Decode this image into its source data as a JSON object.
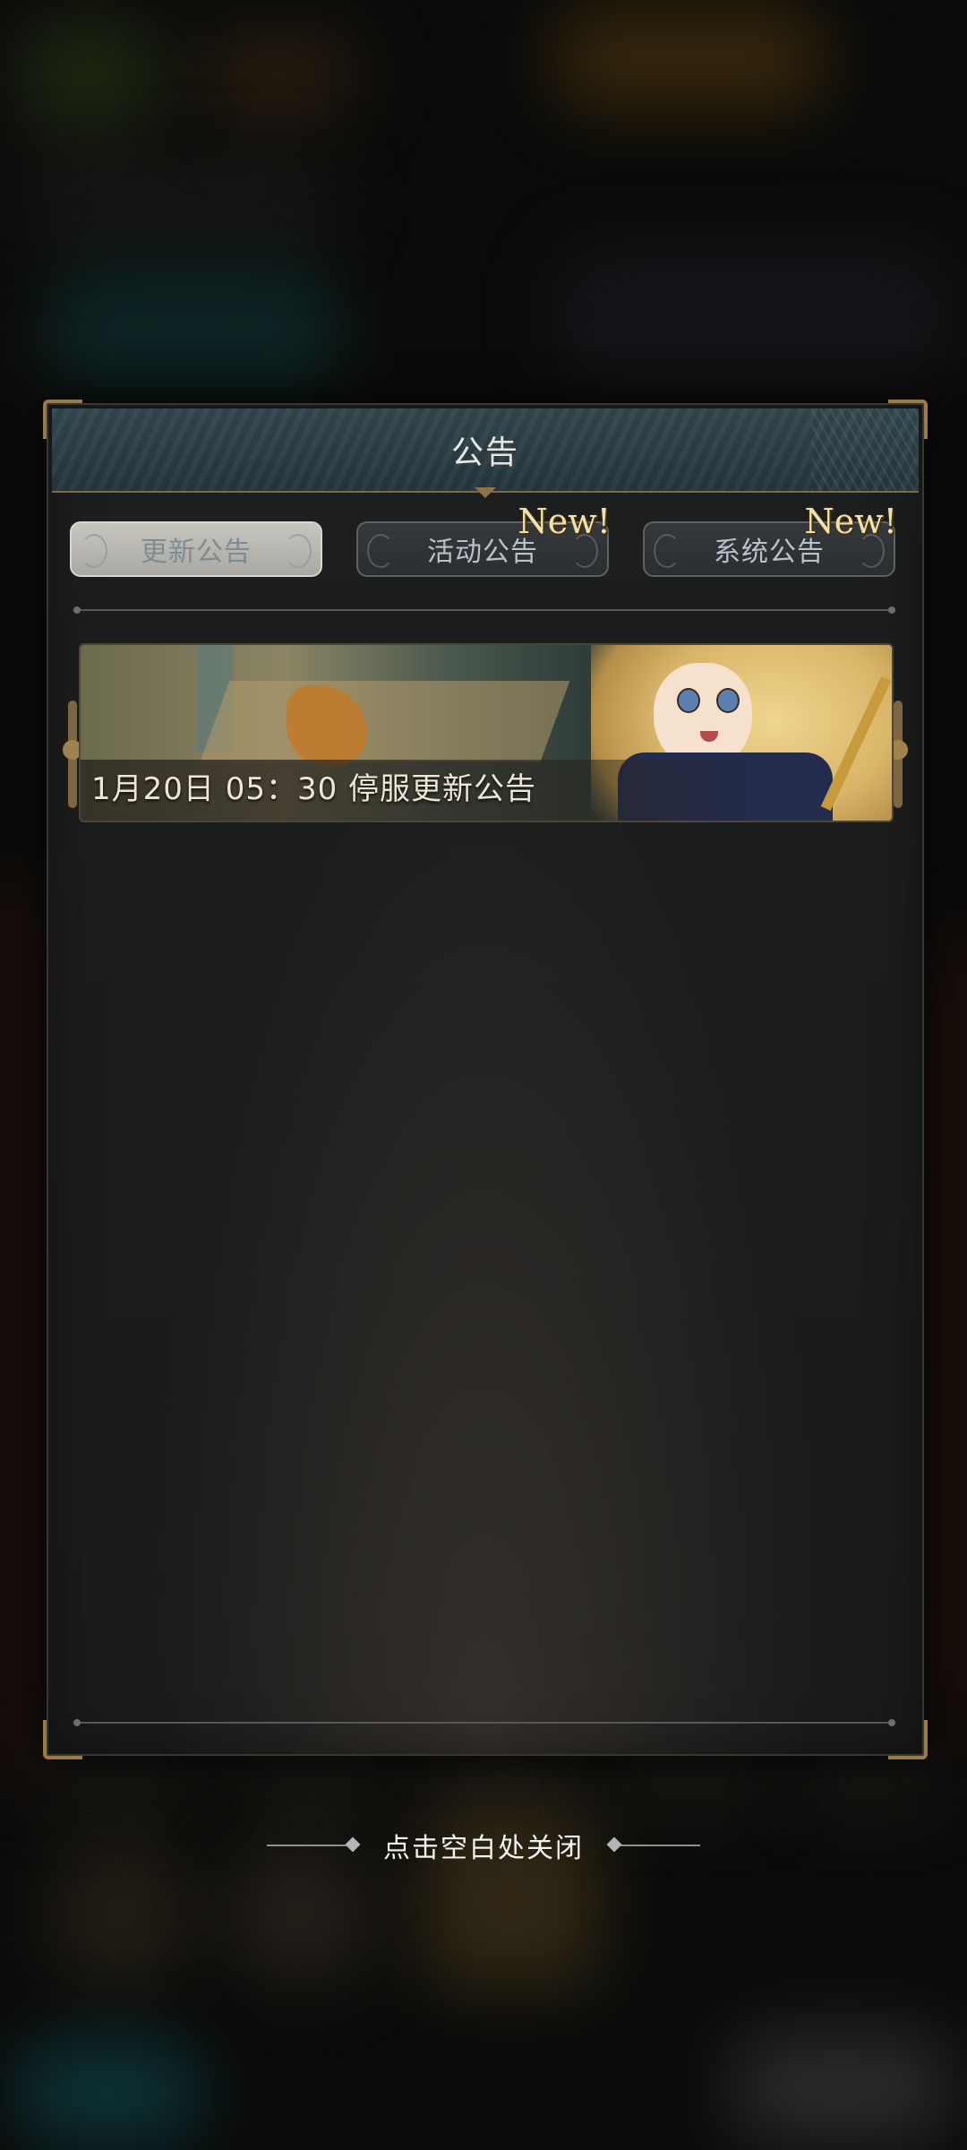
{
  "dialog": {
    "title": "公告",
    "tabs": [
      {
        "label": "更新公告",
        "active": true,
        "badge": ""
      },
      {
        "label": "活动公告",
        "active": false,
        "badge": "New!"
      },
      {
        "label": "系统公告",
        "active": false,
        "badge": "New!"
      }
    ],
    "announcements": [
      {
        "caption": "1月20日 05：30 停服更新公告"
      }
    ]
  },
  "close_hint": "点击空白处关闭",
  "colors": {
    "title_bar": "#2e414a",
    "accent_gold": "#9a7a46",
    "badge_text": "#f3e1a8",
    "active_tab": "#bfbdb6",
    "panel_bg": "#1b1b1b"
  }
}
